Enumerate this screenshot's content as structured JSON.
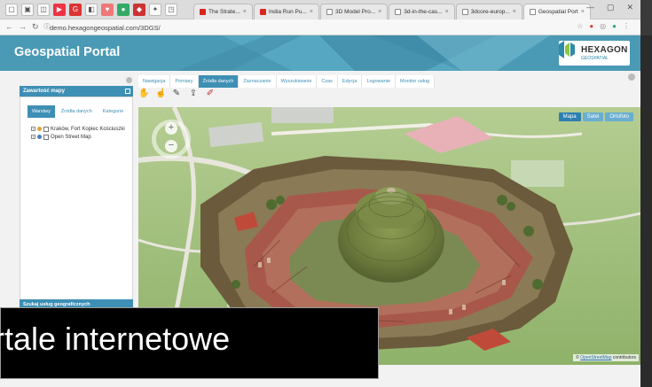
{
  "browser": {
    "tabs": [
      {
        "label": "The Strate...",
        "icon": "youtube"
      },
      {
        "label": "India Run Pu...",
        "icon": "youtube"
      },
      {
        "label": "3D Model Pro...",
        "icon": "page"
      },
      {
        "label": "3d-in-the-cas...",
        "icon": "page"
      },
      {
        "label": "3dcore-europ...",
        "icon": "page"
      },
      {
        "label": "Geospatial Port",
        "icon": "page",
        "active": true
      }
    ],
    "url": "demo.hexagongeospatial.com/3DGS/"
  },
  "portal": {
    "title": "Geospatial Portal",
    "logo_text": "HEXAGON",
    "logo_sub": "GEOSPATIAL",
    "header_color": "#4a9ab5",
    "accent": "#3e8fb4"
  },
  "left_panel": {
    "title": "Zawartość mapy",
    "tabs": [
      "Warstwy",
      "Źródła danych",
      "Kategorie"
    ],
    "layers": [
      "Kraków, Fort Kopiec Kościuszki",
      "Open Street Map"
    ],
    "bottom_section": "Szukaj usług geograficznych"
  },
  "module_tabs": [
    "Nawigacja",
    "Pomiary",
    "Źródła danych",
    "Zaznaczanie",
    "Wyszukiwanie",
    "Czas",
    "Edycja",
    "Logowanie",
    "Monitor usług"
  ],
  "active_module": "Źródła danych",
  "toolbar_icons": [
    "pan-icon",
    "select-icon",
    "draw-icon",
    "export-icon",
    "clear-icon"
  ],
  "map": {
    "layer_switch": [
      "Mapa",
      "Satel",
      "Ortofoto"
    ],
    "active_layer": "Mapa",
    "attribution_prefix": "©",
    "attribution_link": "OpenStreetMap",
    "attribution_suffix": "contributors"
  },
  "caption": {
    "text": "rtale internetowe"
  }
}
